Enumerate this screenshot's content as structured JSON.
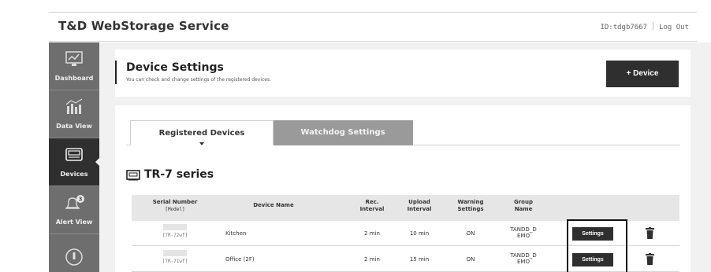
{
  "header": {
    "brand": "T&D WebStorage Service",
    "user_id": "ID:tdgb7667",
    "logout": "Log Out"
  },
  "sidebar": {
    "items": [
      {
        "label": "Dashboard",
        "icon": "dashboard-icon"
      },
      {
        "label": "Data View",
        "icon": "data-view-icon"
      },
      {
        "label": "Devices",
        "icon": "devices-icon",
        "active": true
      },
      {
        "label": "Alert View",
        "icon": "alert-bell-icon",
        "badge": "3"
      },
      {
        "label": "",
        "icon": "info-icon"
      }
    ]
  },
  "page": {
    "title": "Device Settings",
    "description": "You can check and change settings of the registered devices.",
    "add_button": "+ Device"
  },
  "tabs": {
    "registered": "Registered Devices",
    "watchdog": "Watchdog Settings"
  },
  "series": {
    "title": "TR-7 series"
  },
  "table": {
    "headers": {
      "serial": "Serial Number",
      "model": "[Model]",
      "device_name": "Device Name",
      "rec_interval": "Rec. Interval",
      "upload_interval": "Upload Interval",
      "warning_settings": "Warning Settings",
      "group_name": "Group Name"
    },
    "rows": [
      {
        "model": "[TR-72wf]",
        "device_name": "Kitchen",
        "rec": "2 min",
        "upload": "10 min",
        "warning": "ON",
        "group": "TANDD_D EMO",
        "action": "Settings"
      },
      {
        "model": "[TR-71wf]",
        "device_name": "Office (2F)",
        "rec": "2 min",
        "upload": "15 min",
        "warning": "ON",
        "group": "TANDD_D EMO",
        "action": "Settings"
      }
    ]
  },
  "colors": {
    "sidebar": "#6e6e6e",
    "sidebar_active": "#2f2f2f",
    "button_dark": "#2f2f2f",
    "tab_inactive": "#9a9a9a",
    "content_bg": "#f1f1f1"
  }
}
